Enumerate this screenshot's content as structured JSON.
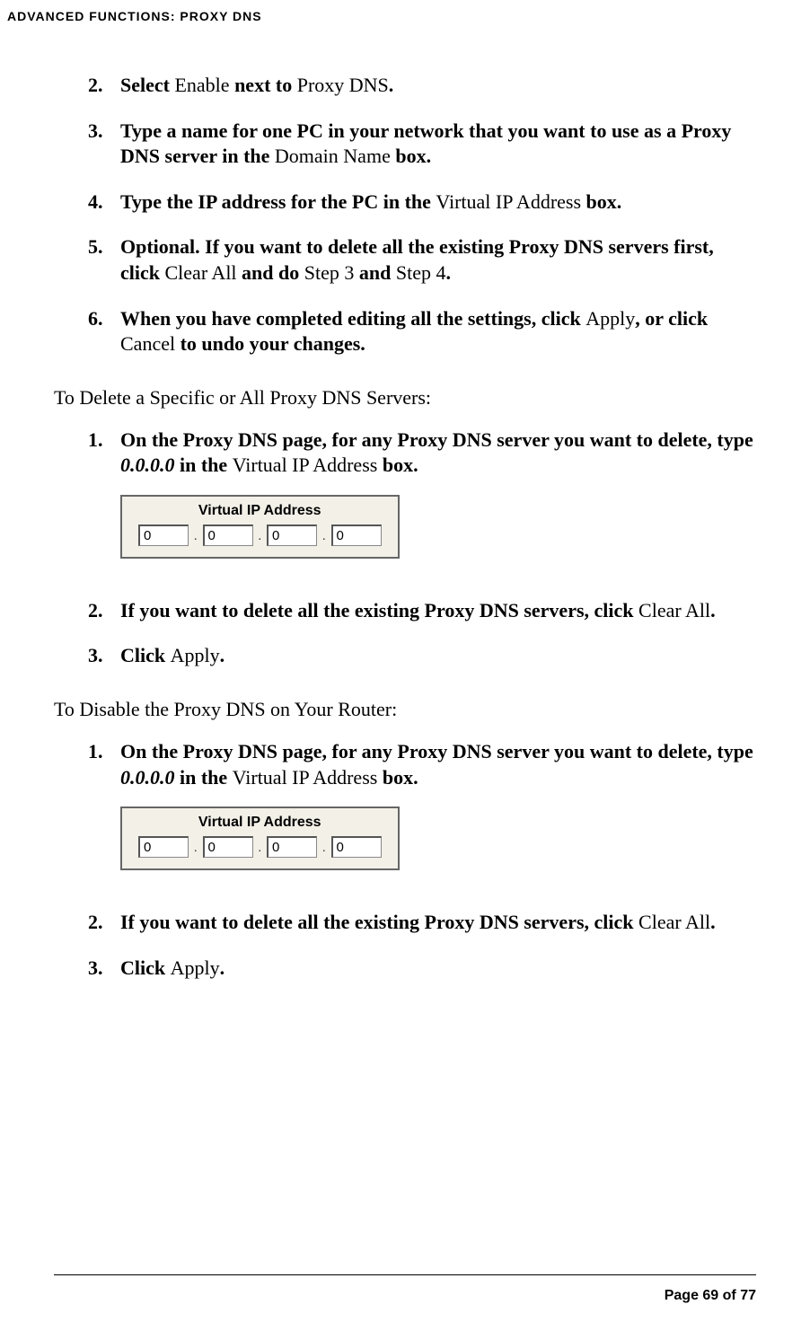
{
  "header": {
    "title": "ADVANCED FUNCTIONS: PROXY DNS"
  },
  "list1": {
    "item2": {
      "num": "2.",
      "t1": "Select ",
      "t2": "Enable",
      "t3": " next to ",
      "t4": "Proxy DNS",
      "t5": "."
    },
    "item3": {
      "num": "3.",
      "t1": "Type a name for one PC in your network that you want to use as a Proxy DNS server in the ",
      "t2": "Domain Name",
      "t3": " box."
    },
    "item4": {
      "num": "4.",
      "t1": "Type the IP address for the PC in the ",
      "t2": "Virtual IP Address",
      "t3": " box."
    },
    "item5": {
      "num": "5.",
      "t1": "Optional. If you want to delete all the existing Proxy DNS servers first, click ",
      "t2": "Clear All",
      "t3": " and do ",
      "t4": "Step 3",
      "t5": " and ",
      "t6": "Step 4",
      "t7": "."
    },
    "item6": {
      "num": "6.",
      "t1": "When you have completed editing all the settings, click ",
      "t2": "Apply",
      "t3": ", or click ",
      "t4": "Cancel",
      "t5": " to undo your changes."
    }
  },
  "section2": {
    "heading": "To Delete a Specific or All Proxy DNS Servers:",
    "item1": {
      "num": "1.",
      "t1": "On the Proxy DNS page, for any Proxy DNS server you want to delete, type ",
      "t2": "0.0.0.0",
      "t3": " in the ",
      "t4": "Virtual IP Address",
      "t5": " box."
    },
    "ipbox": {
      "label": "Virtual IP Address",
      "v1": "0",
      "v2": "0",
      "v3": "0",
      "v4": "0"
    },
    "item2": {
      "num": "2.",
      "t1": "If you want to delete all the existing Proxy DNS servers, click ",
      "t2": "Clear All",
      "t3": "."
    },
    "item3": {
      "num": "3.",
      "t1": "Click ",
      "t2": "Apply",
      "t3": "."
    }
  },
  "section3": {
    "heading": "To Disable the Proxy DNS on Your Router:",
    "item1": {
      "num": "1.",
      "t1": "On the Proxy DNS page, for any Proxy DNS server you want to delete, type ",
      "t2": "0.0.0.0",
      "t3": " in the ",
      "t4": "Virtual IP Address",
      "t5": " box."
    },
    "ipbox": {
      "label": "Virtual IP Address",
      "v1": "0",
      "v2": "0",
      "v3": "0",
      "v4": "0"
    },
    "item2": {
      "num": "2.",
      "t1": "If you want to delete all the existing Proxy DNS servers, click ",
      "t2": "Clear All",
      "t3": "."
    },
    "item3": {
      "num": "3.",
      "t1": "Click ",
      "t2": "Apply",
      "t3": "."
    }
  },
  "footer": {
    "text": "Page 69 of 77"
  }
}
